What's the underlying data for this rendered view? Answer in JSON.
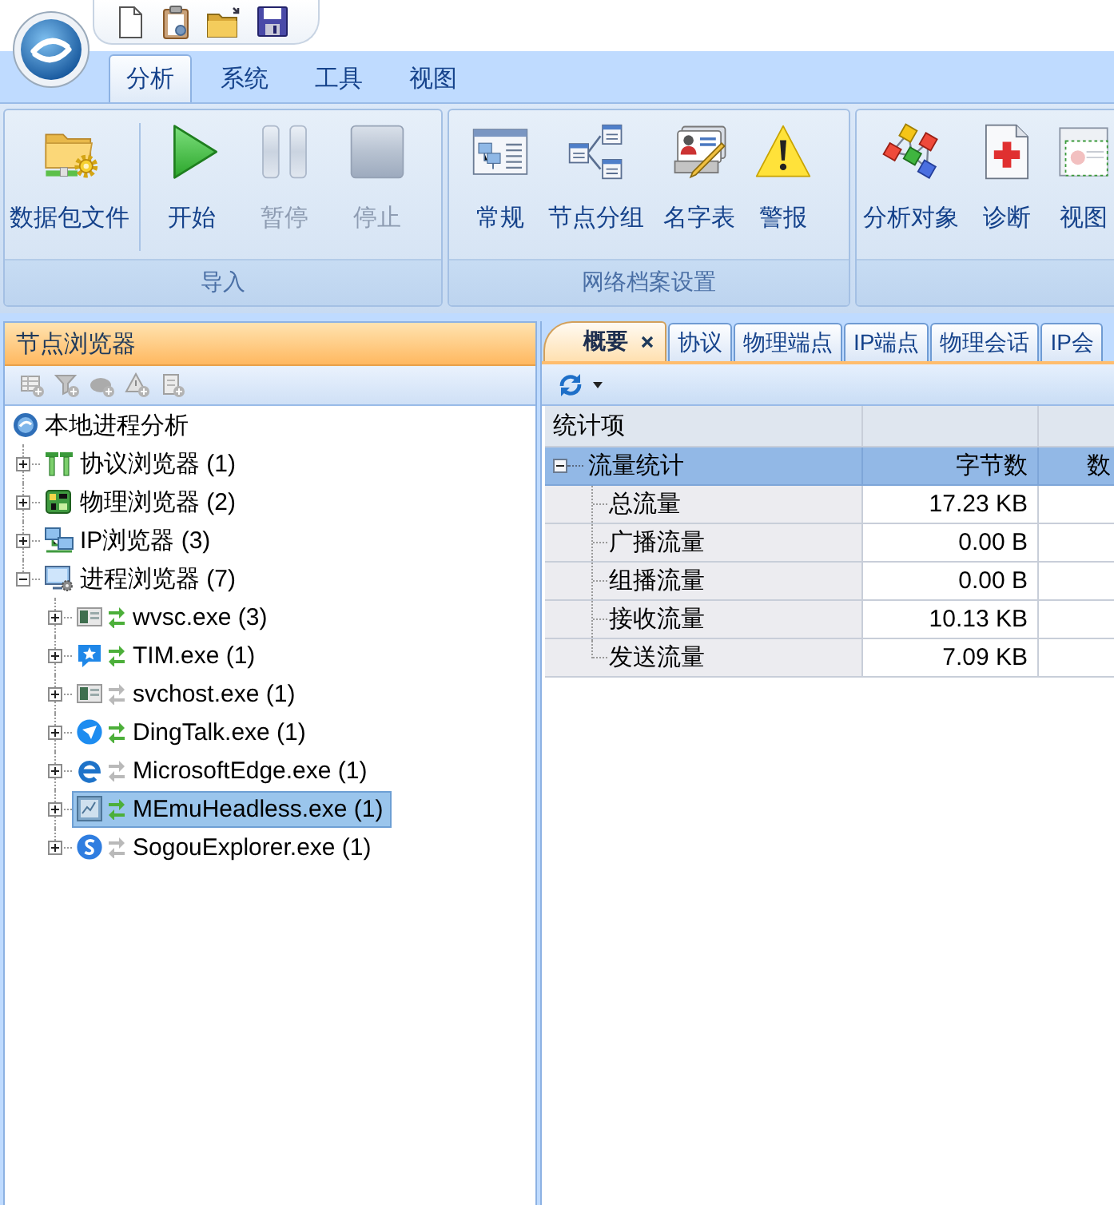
{
  "ribbon": {
    "tabs": [
      {
        "label": "分析",
        "selected": true
      },
      {
        "label": "系统",
        "selected": false
      },
      {
        "label": "工具",
        "selected": false
      },
      {
        "label": "视图",
        "selected": false
      }
    ],
    "groups": [
      {
        "label": "导入",
        "buttons": [
          {
            "label": "数据包文件",
            "disabled": false
          },
          {
            "label": "开始",
            "disabled": false
          },
          {
            "label": "暂停",
            "disabled": true
          },
          {
            "label": "停止",
            "disabled": true
          }
        ]
      },
      {
        "label": "网络档案设置",
        "buttons": [
          {
            "label": "常规",
            "disabled": false
          },
          {
            "label": "节点分组",
            "disabled": false
          },
          {
            "label": "名字表",
            "disabled": false
          },
          {
            "label": "警报",
            "disabled": false
          }
        ]
      },
      {
        "buttons": [
          {
            "label": "分析对象",
            "disabled": false
          },
          {
            "label": "诊断",
            "disabled": false
          },
          {
            "label": "视图",
            "disabled": false
          }
        ]
      }
    ]
  },
  "node_browser": {
    "title": "节点浏览器",
    "tree": [
      {
        "label": "本地进程分析",
        "selected": false,
        "children": [
          {
            "label": "协议浏览器 (1)",
            "expanded": false,
            "selected": false
          },
          {
            "label": "物理浏览器 (2)",
            "expanded": false,
            "selected": false
          },
          {
            "label": "IP浏览器 (3)",
            "expanded": false,
            "selected": false
          },
          {
            "label": "进程浏览器 (7)",
            "expanded": true,
            "selected": false,
            "children": [
              {
                "label": "wvsc.exe (3)",
                "expanded": false,
                "selected": false,
                "active": true
              },
              {
                "label": "TIM.exe (1)",
                "expanded": false,
                "selected": false,
                "active": true
              },
              {
                "label": "svchost.exe (1)",
                "expanded": false,
                "selected": false,
                "active": false
              },
              {
                "label": "DingTalk.exe (1)",
                "expanded": false,
                "selected": false,
                "active": true
              },
              {
                "label": "MicrosoftEdge.exe (1)",
                "expanded": false,
                "selected": false,
                "active": false
              },
              {
                "label": "MEmuHeadless.exe (1)",
                "expanded": false,
                "selected": true,
                "active": true
              },
              {
                "label": "SogouExplorer.exe (1)",
                "expanded": false,
                "selected": false,
                "active": false
              }
            ]
          }
        ]
      }
    ]
  },
  "analysis": {
    "tabs": [
      {
        "label": "概要",
        "selected": true
      },
      {
        "label": "协议",
        "selected": false
      },
      {
        "label": "物理端点",
        "selected": false
      },
      {
        "label": "IP端点",
        "selected": false
      },
      {
        "label": "物理会话",
        "selected": false
      },
      {
        "label": "IP会",
        "selected": false
      }
    ],
    "table": {
      "header": "统计项",
      "groups": [
        {
          "label": "流量统计",
          "expanded": true,
          "column_2": "字节数",
          "column_3": "数",
          "rows": [
            {
              "label": "总流量",
              "value": "17.23 KB"
            },
            {
              "label": "广播流量",
              "value": "0.00 B"
            },
            {
              "label": "组播流量",
              "value": "0.00 B"
            },
            {
              "label": "接收流量",
              "value": "10.13 KB"
            },
            {
              "label": "发送流量",
              "value": "7.09 KB"
            }
          ]
        }
      ]
    }
  }
}
